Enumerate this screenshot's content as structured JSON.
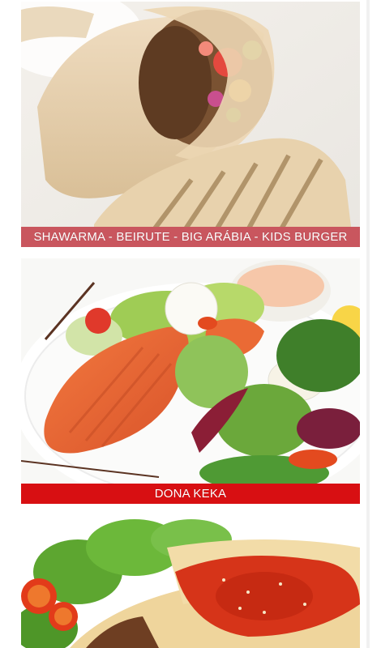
{
  "colors": {
    "banner_muted": "#c9565e",
    "banner_strong": "#d80f12"
  },
  "categories": [
    {
      "id": "shawarma",
      "label": "SHAWARMA - BEIRUTE - BIG ARÁBIA - KIDS BURGER",
      "image": "shawarma-wrap-photo"
    },
    {
      "id": "dona-keka",
      "label": "DONA KEKA",
      "image": "salmon-salad-photo"
    },
    {
      "id": "crepes",
      "label": "",
      "image": "crepes-with-sauce-photo"
    }
  ]
}
